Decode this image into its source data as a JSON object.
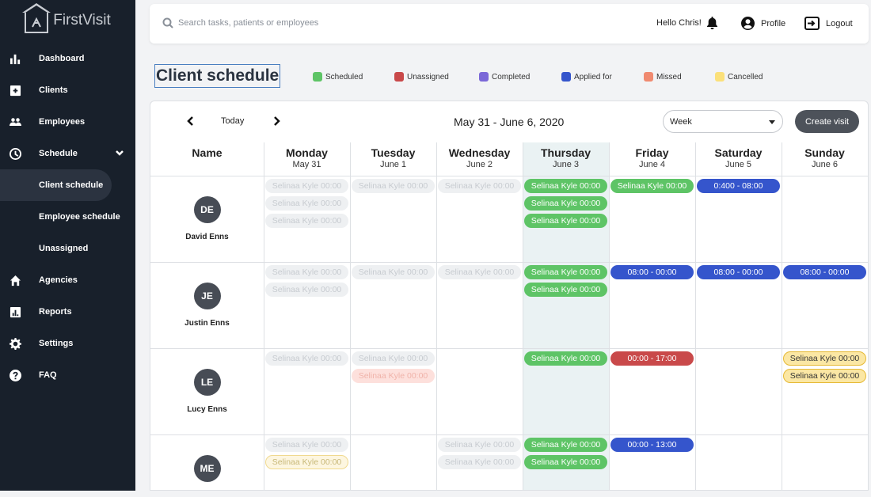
{
  "brand": {
    "name": "FirstVisit"
  },
  "sidebar": {
    "items": [
      {
        "label": "Dashboard",
        "icon": "bar-chart-icon"
      },
      {
        "label": "Clients",
        "icon": "plus-square-icon"
      },
      {
        "label": "Employees",
        "icon": "people-icon"
      },
      {
        "label": "Schedule",
        "icon": "clock-icon"
      },
      {
        "label": "Client schedule"
      },
      {
        "label": "Employee schedule"
      },
      {
        "label": "Unassigned"
      },
      {
        "label": "Agencies",
        "icon": "home-icon"
      },
      {
        "label": "Reports",
        "icon": "report-icon"
      },
      {
        "label": "Settings",
        "icon": "gear-icon"
      },
      {
        "label": "FAQ",
        "icon": "question-icon"
      }
    ]
  },
  "topbar": {
    "search_placeholder": "Search tasks, patients or employees",
    "greeting": "Hello Chris!",
    "profile": "Profile",
    "logout": "Logout"
  },
  "page": {
    "title": "Client schedule",
    "legend": [
      {
        "label": "Scheduled",
        "color": "#5ec466"
      },
      {
        "label": "Unassigned",
        "color": "#c9494a"
      },
      {
        "label": "Completed",
        "color": "#7b68d8"
      },
      {
        "label": "Applied for",
        "color": "#3555cc"
      },
      {
        "label": "Missed",
        "color": "#f08a70"
      },
      {
        "label": "Cancelled",
        "color": "#fbe07a"
      }
    ]
  },
  "schedule": {
    "today": "Today",
    "range": "May 31 - June 6, 2020",
    "view": "Week",
    "create": "Create visit",
    "name_header": "Name",
    "days": [
      {
        "day": "Monday",
        "date": "May 31"
      },
      {
        "day": "Tuesday",
        "date": "June 1"
      },
      {
        "day": "Wednesday",
        "date": "June 2"
      },
      {
        "day": "Thursday",
        "date": "June 3"
      },
      {
        "day": "Friday",
        "date": "June 4"
      },
      {
        "day": "Saturday",
        "date": "June 5"
      },
      {
        "day": "Sunday",
        "date": "June 6"
      }
    ],
    "clients": [
      {
        "initials": "DE",
        "name": "David Enns",
        "visits": [
          [
            "Selinaa Kyle 00:00",
            "Selinaa Kyle 00:00",
            "Selinaa Kyle 00:00"
          ],
          [
            "Selinaa Kyle 00:00"
          ],
          [
            "Selinaa Kyle 00:00"
          ],
          [
            "Selinaa Kyle 00:00",
            "Selinaa Kyle 00:00",
            "Selinaa Kyle 00:00"
          ],
          [
            "Selinaa Kyle 00:00"
          ],
          [
            "0:400 - 08:00"
          ],
          []
        ]
      },
      {
        "initials": "JE",
        "name": "Justin Enns",
        "visits": [
          [
            "Selinaa Kyle 00:00",
            "Selinaa Kyle 00:00"
          ],
          [
            "Selinaa Kyle 00:00"
          ],
          [
            "Selinaa Kyle 00:00"
          ],
          [
            "Selinaa Kyle 00:00",
            "Selinaa Kyle 00:00"
          ],
          [
            "08:00 - 00:00"
          ],
          [
            "08:00 - 00:00"
          ],
          [
            "08:00 - 00:00"
          ]
        ]
      },
      {
        "initials": "LE",
        "name": "Lucy Enns",
        "visits": [
          [
            "Selinaa Kyle 00:00"
          ],
          [
            "Selinaa Kyle 00:00",
            "Selinaa Kyle 00:00"
          ],
          [],
          [
            "Selinaa Kyle 00:00"
          ],
          [
            "00:00 - 17:00"
          ],
          [],
          [
            "Selinaa Kyle 00:00",
            "Selinaa Kyle 00:00"
          ]
        ]
      },
      {
        "initials": "ME",
        "name": "",
        "visits": [
          [
            "Selinaa Kyle 00:00",
            "Selinaa Kyle 00:00"
          ],
          [],
          [
            "Selinaa Kyle 00:00",
            "Selinaa Kyle 00:00"
          ],
          [
            "Selinaa Kyle 00:00",
            "Selinaa Kyle 00:00"
          ],
          [
            "00:00 - 13:00"
          ],
          [],
          []
        ]
      }
    ]
  }
}
